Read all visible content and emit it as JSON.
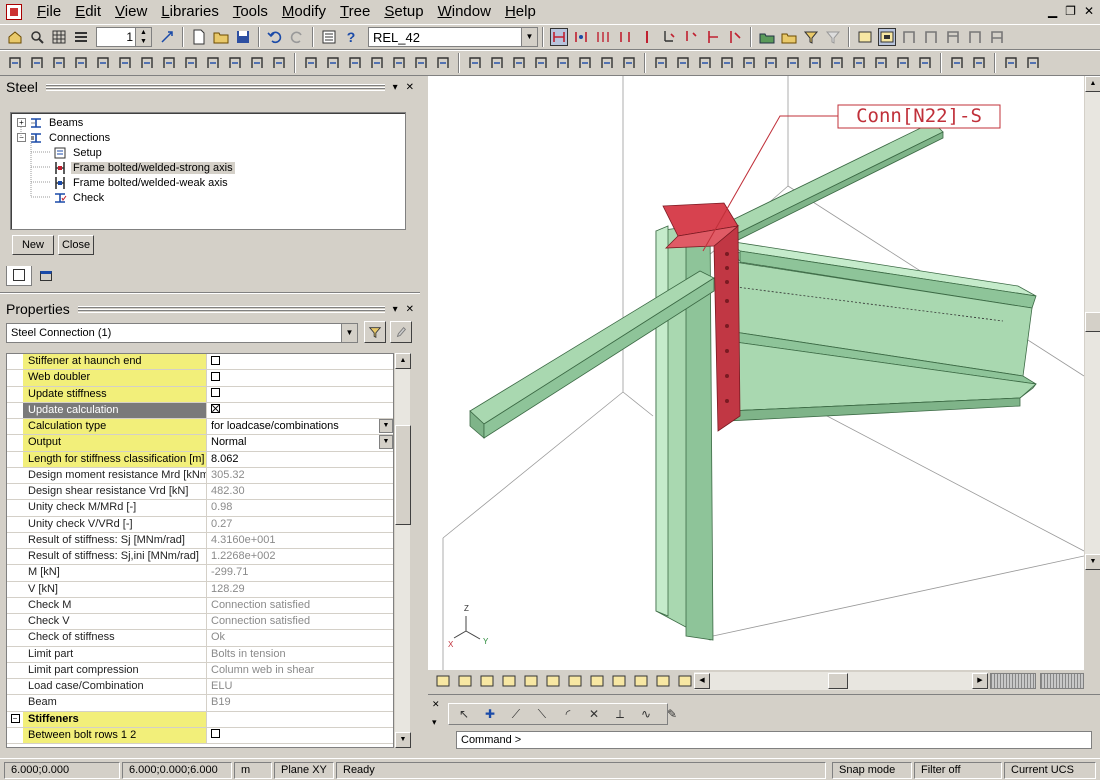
{
  "menubar": {
    "items": [
      "File",
      "Edit",
      "View",
      "Libraries",
      "Tools",
      "Modify",
      "Tree",
      "Setup",
      "Window",
      "Help"
    ]
  },
  "toolbar": {
    "spin_value": "1",
    "model_combo": "REL_42"
  },
  "steel_panel": {
    "title": "Steel",
    "tree": [
      {
        "label": "Beams",
        "icon": "beam-icon"
      },
      {
        "label": "Connections",
        "icon": "connection-icon"
      },
      {
        "label": "Setup",
        "icon": "setup-icon"
      },
      {
        "label": "Frame bolted/welded-strong axis",
        "icon": "frame-strong-icon"
      },
      {
        "label": "Frame bolted/welded-weak axis",
        "icon": "frame-weak-icon"
      },
      {
        "label": "Check",
        "icon": "check-icon"
      }
    ],
    "new_button": "New",
    "close_button": "Close"
  },
  "properties": {
    "title": "Properties",
    "selector": "Steel Connection (1)",
    "rows": [
      {
        "name": "Stiffener at haunch end",
        "value": "",
        "checkbox": "unchecked",
        "style": "yellow"
      },
      {
        "name": "Web doubler",
        "value": "",
        "checkbox": "unchecked",
        "style": "yellow"
      },
      {
        "name": "Update stiffness",
        "value": "",
        "checkbox": "unchecked",
        "style": "yellow"
      },
      {
        "name": "Update calculation",
        "value": "",
        "checkbox": "checked",
        "style": "grey"
      },
      {
        "name": "Calculation type",
        "value": "for loadcase/combinations",
        "dropdown": true,
        "style": "yellow"
      },
      {
        "name": "Output",
        "value": "Normal",
        "dropdown": true,
        "style": "yellow"
      },
      {
        "name": "Length for stiffness classification [m]",
        "value": "8.062",
        "style": "yellow"
      },
      {
        "name": "Design moment resistance Mrd [kNm]",
        "value": "305.32",
        "style": "ro"
      },
      {
        "name": "Design shear resistance Vrd [kN]",
        "value": "482.30",
        "style": "ro"
      },
      {
        "name": "Unity check M/MRd  [-]",
        "value": "0.98",
        "style": "ro"
      },
      {
        "name": "Unity check V/VRd  [-]",
        "value": "0.27",
        "style": "ro"
      },
      {
        "name": "Result of stiffness: Sj [MNm/rad]",
        "value": "4.3160e+001",
        "style": "ro"
      },
      {
        "name": "Result of stiffness: Sj,ini [MNm/rad]",
        "value": "1.2268e+002",
        "style": "ro"
      },
      {
        "name": "M [kN]",
        "value": "-299.71",
        "style": "ro"
      },
      {
        "name": "V [kN]",
        "value": "128.29",
        "style": "ro"
      },
      {
        "name": "Check M",
        "value": "Connection satisfied",
        "style": "ro"
      },
      {
        "name": "Check V",
        "value": "Connection satisfied",
        "style": "ro"
      },
      {
        "name": "Check of stiffness",
        "value": "Ok",
        "style": "ro"
      },
      {
        "name": "Limit part",
        "value": "Bolts in tension",
        "style": "ro"
      },
      {
        "name": "Limit part compression",
        "value": "Column web in shear",
        "style": "ro"
      },
      {
        "name": "Load case/Combination",
        "value": "ELU",
        "style": "ro"
      },
      {
        "name": "Beam",
        "value": "B19",
        "style": "ro"
      },
      {
        "name": "Stiffeners",
        "value": "",
        "style": "section"
      },
      {
        "name": "Between bolt rows 1 2",
        "value": "",
        "checkbox": "unchecked",
        "style": "yellow"
      }
    ]
  },
  "viewport": {
    "label": "Conn[N22]-S",
    "axes": {
      "z": "Z",
      "x": "X",
      "y": "Y"
    }
  },
  "command": {
    "prompt": "Command >"
  },
  "status": {
    "coord1": "6.000;0.000",
    "coord2": "6.000;0.000;6.000",
    "units": "m",
    "plane": "Plane XY",
    "state": "Ready",
    "snap": "Snap mode",
    "filter": "Filter off",
    "ucs": "Current UCS"
  },
  "colors": {
    "beam_green": "#a9d8b0",
    "endplate_red": "#d7424f",
    "highlight_yellow": "#f2ef7a",
    "label_outline": "#c0303a"
  }
}
